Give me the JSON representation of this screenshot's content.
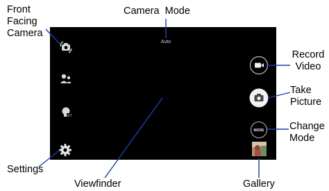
{
  "callouts": {
    "front_facing_camera": [
      "Front",
      "Facing",
      "Camera"
    ],
    "camera_mode": "Camera  Mode",
    "record_video": [
      "Record",
      "Video"
    ],
    "take_picture": [
      "Take",
      "Picture"
    ],
    "change_mode": [
      "Change",
      "Mode"
    ],
    "settings": "Settings",
    "viewfinder": "Viewfinder",
    "gallery": "Gallery"
  },
  "screen": {
    "mode_text": "Auto",
    "mode_button_text": "MODE"
  },
  "colors": {
    "callout_line": "#1f3fae",
    "screen_background": "#000000",
    "icon_light": "#d9d9d9",
    "shutter_button": "#f2f2f2"
  },
  "icons": [
    "switch-camera-icon",
    "face-detection-icon",
    "hdr-off-icon",
    "gear-icon",
    "video-camera-icon",
    "camera-icon",
    "gallery-thumbnail"
  ]
}
